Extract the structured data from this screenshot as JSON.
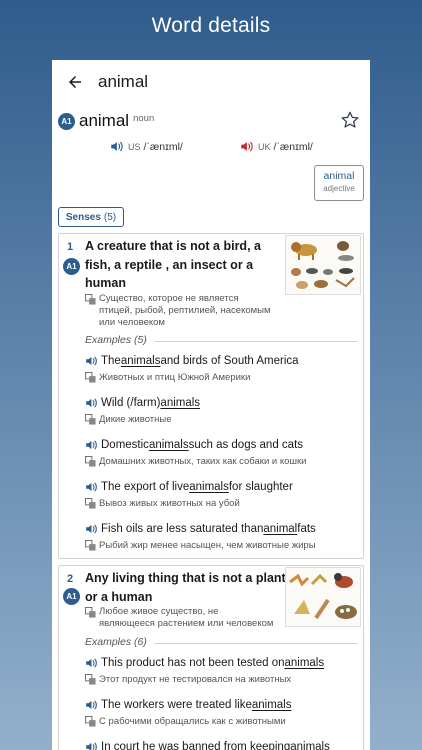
{
  "hero_title": "Word details",
  "appbar": {
    "title": "animal"
  },
  "entry": {
    "level": "A1",
    "headword": "animal",
    "pos": "noun",
    "pron_us": {
      "region": "US",
      "ipa": "/ˈænɪml/"
    },
    "pron_uk": {
      "region": "UK",
      "ipa": "/ˈænɪml/"
    },
    "related": {
      "word": "animal",
      "pos": "adjective"
    },
    "senses_tab": {
      "label": "Senses",
      "count": "(5)"
    }
  },
  "senses": [
    {
      "num": "1",
      "level": "A1",
      "definition_lines": [
        "A creature that is not a bird, a",
        "fish, a reptile , an insect or a",
        "human"
      ],
      "translation_lines": [
        "Существо, которое не является",
        "птицей, рыбой, рептилией, насекомым",
        "или человеком"
      ],
      "examples_label": "Examples",
      "examples_count": "(5)",
      "examples": [
        {
          "pre": "The ",
          "hl": "animals",
          "post": " and birds of South America",
          "ru": "Животных и птиц Южной Америки"
        },
        {
          "pre": "Wild (/farm) ",
          "hl": "animals",
          "post": "",
          "ru": "Дикие животные"
        },
        {
          "pre": "Domestic ",
          "hl": "animals",
          "post": " such as dogs and cats",
          "ru": "Домашних животных, таких как собаки и кошки"
        },
        {
          "pre": "The export of live ",
          "hl": "animals",
          "post": " for slaughter",
          "ru": "Вывоз живых животных на убой"
        },
        {
          "pre": "Fish oils are less saturated than ",
          "hl": "animal",
          "post": " fats",
          "ru": "Рыбий жир менее насыщен, чем животные жиры"
        }
      ]
    },
    {
      "num": "2",
      "level": "A1",
      "definition_lines": [
        "Any living thing that is not a plant",
        "or a human"
      ],
      "translation_lines": [
        "Любое живое существо, не",
        "являющееся растением или человеком"
      ],
      "examples_label": "Examples",
      "examples_count": "(6)",
      "examples": [
        {
          "pre": "This product has not been tested on ",
          "hl": "animals",
          "post": "",
          "ru": "Этот продукт не тестировался на животных"
        },
        {
          "pre": "The workers were treated like ",
          "hl": "animals",
          "post": "",
          "ru": "С рабочими обращались как с животными"
        },
        {
          "pre": "In court he was banned from keeping ",
          "hl": "animals",
          "post": "",
          "ru": ""
        }
      ]
    }
  ],
  "colors": {
    "accent": "#2d5d8e",
    "speaker_us": "#2d5d8e",
    "speaker_uk": "#c62828",
    "background_top": "#2f5c8b",
    "background_bottom": "#93b0cb"
  }
}
